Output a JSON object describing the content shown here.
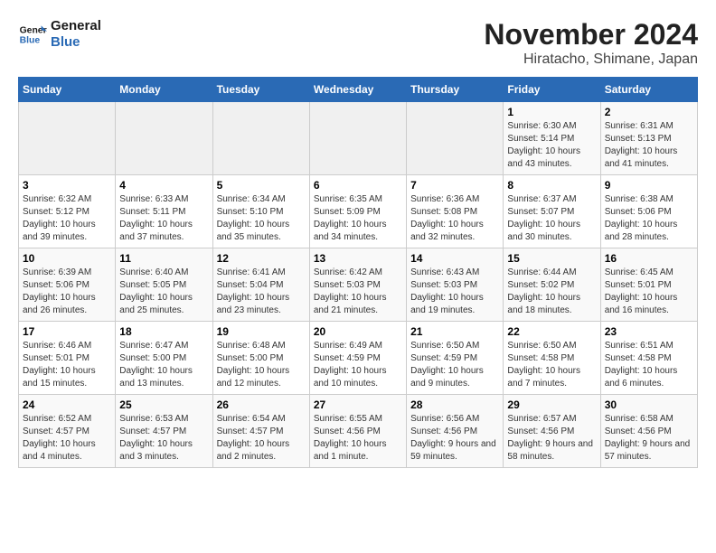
{
  "logo": {
    "line1": "General",
    "line2": "Blue"
  },
  "title": "November 2024",
  "subtitle": "Hiratacho, Shimane, Japan",
  "weekdays": [
    "Sunday",
    "Monday",
    "Tuesday",
    "Wednesday",
    "Thursday",
    "Friday",
    "Saturday"
  ],
  "weeks": [
    [
      {
        "day": "",
        "info": ""
      },
      {
        "day": "",
        "info": ""
      },
      {
        "day": "",
        "info": ""
      },
      {
        "day": "",
        "info": ""
      },
      {
        "day": "",
        "info": ""
      },
      {
        "day": "1",
        "info": "Sunrise: 6:30 AM\nSunset: 5:14 PM\nDaylight: 10 hours and 43 minutes."
      },
      {
        "day": "2",
        "info": "Sunrise: 6:31 AM\nSunset: 5:13 PM\nDaylight: 10 hours and 41 minutes."
      }
    ],
    [
      {
        "day": "3",
        "info": "Sunrise: 6:32 AM\nSunset: 5:12 PM\nDaylight: 10 hours and 39 minutes."
      },
      {
        "day": "4",
        "info": "Sunrise: 6:33 AM\nSunset: 5:11 PM\nDaylight: 10 hours and 37 minutes."
      },
      {
        "day": "5",
        "info": "Sunrise: 6:34 AM\nSunset: 5:10 PM\nDaylight: 10 hours and 35 minutes."
      },
      {
        "day": "6",
        "info": "Sunrise: 6:35 AM\nSunset: 5:09 PM\nDaylight: 10 hours and 34 minutes."
      },
      {
        "day": "7",
        "info": "Sunrise: 6:36 AM\nSunset: 5:08 PM\nDaylight: 10 hours and 32 minutes."
      },
      {
        "day": "8",
        "info": "Sunrise: 6:37 AM\nSunset: 5:07 PM\nDaylight: 10 hours and 30 minutes."
      },
      {
        "day": "9",
        "info": "Sunrise: 6:38 AM\nSunset: 5:06 PM\nDaylight: 10 hours and 28 minutes."
      }
    ],
    [
      {
        "day": "10",
        "info": "Sunrise: 6:39 AM\nSunset: 5:06 PM\nDaylight: 10 hours and 26 minutes."
      },
      {
        "day": "11",
        "info": "Sunrise: 6:40 AM\nSunset: 5:05 PM\nDaylight: 10 hours and 25 minutes."
      },
      {
        "day": "12",
        "info": "Sunrise: 6:41 AM\nSunset: 5:04 PM\nDaylight: 10 hours and 23 minutes."
      },
      {
        "day": "13",
        "info": "Sunrise: 6:42 AM\nSunset: 5:03 PM\nDaylight: 10 hours and 21 minutes."
      },
      {
        "day": "14",
        "info": "Sunrise: 6:43 AM\nSunset: 5:03 PM\nDaylight: 10 hours and 19 minutes."
      },
      {
        "day": "15",
        "info": "Sunrise: 6:44 AM\nSunset: 5:02 PM\nDaylight: 10 hours and 18 minutes."
      },
      {
        "day": "16",
        "info": "Sunrise: 6:45 AM\nSunset: 5:01 PM\nDaylight: 10 hours and 16 minutes."
      }
    ],
    [
      {
        "day": "17",
        "info": "Sunrise: 6:46 AM\nSunset: 5:01 PM\nDaylight: 10 hours and 15 minutes."
      },
      {
        "day": "18",
        "info": "Sunrise: 6:47 AM\nSunset: 5:00 PM\nDaylight: 10 hours and 13 minutes."
      },
      {
        "day": "19",
        "info": "Sunrise: 6:48 AM\nSunset: 5:00 PM\nDaylight: 10 hours and 12 minutes."
      },
      {
        "day": "20",
        "info": "Sunrise: 6:49 AM\nSunset: 4:59 PM\nDaylight: 10 hours and 10 minutes."
      },
      {
        "day": "21",
        "info": "Sunrise: 6:50 AM\nSunset: 4:59 PM\nDaylight: 10 hours and 9 minutes."
      },
      {
        "day": "22",
        "info": "Sunrise: 6:50 AM\nSunset: 4:58 PM\nDaylight: 10 hours and 7 minutes."
      },
      {
        "day": "23",
        "info": "Sunrise: 6:51 AM\nSunset: 4:58 PM\nDaylight: 10 hours and 6 minutes."
      }
    ],
    [
      {
        "day": "24",
        "info": "Sunrise: 6:52 AM\nSunset: 4:57 PM\nDaylight: 10 hours and 4 minutes."
      },
      {
        "day": "25",
        "info": "Sunrise: 6:53 AM\nSunset: 4:57 PM\nDaylight: 10 hours and 3 minutes."
      },
      {
        "day": "26",
        "info": "Sunrise: 6:54 AM\nSunset: 4:57 PM\nDaylight: 10 hours and 2 minutes."
      },
      {
        "day": "27",
        "info": "Sunrise: 6:55 AM\nSunset: 4:56 PM\nDaylight: 10 hours and 1 minute."
      },
      {
        "day": "28",
        "info": "Sunrise: 6:56 AM\nSunset: 4:56 PM\nDaylight: 9 hours and 59 minutes."
      },
      {
        "day": "29",
        "info": "Sunrise: 6:57 AM\nSunset: 4:56 PM\nDaylight: 9 hours and 58 minutes."
      },
      {
        "day": "30",
        "info": "Sunrise: 6:58 AM\nSunset: 4:56 PM\nDaylight: 9 hours and 57 minutes."
      }
    ]
  ]
}
